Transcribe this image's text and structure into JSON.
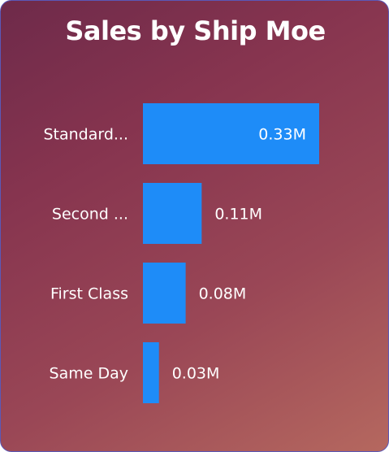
{
  "chart_data": {
    "type": "bar",
    "orientation": "horizontal",
    "title": "Sales by Ship Moe",
    "categories": [
      "Standard...",
      "Second ...",
      "First Class",
      "Same Day"
    ],
    "values": [
      0.33,
      0.11,
      0.08,
      0.03
    ],
    "value_labels": [
      "0.33M",
      "0.11M",
      "0.08M",
      "0.03M"
    ],
    "xlim": [
      0,
      0.33
    ],
    "grid": false,
    "legend": "none"
  },
  "colors": {
    "bar": "#1e8cf8",
    "text": "#ffffff",
    "border": "#5a58b8"
  }
}
